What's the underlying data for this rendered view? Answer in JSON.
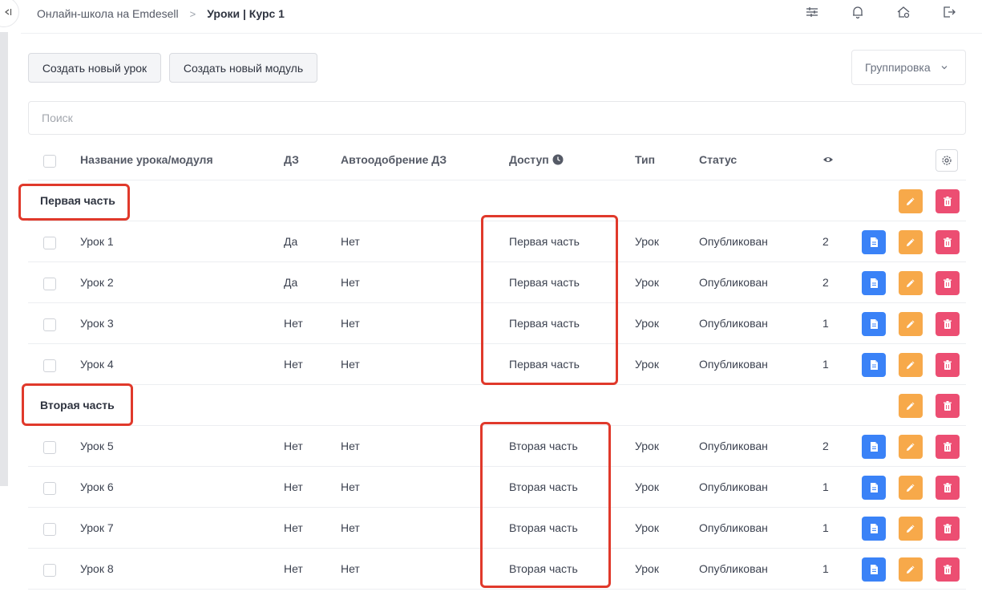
{
  "breadcrumb": {
    "school": "Онлайн-школа на Emdesell",
    "separator": ">",
    "current": "Уроки | Курс 1"
  },
  "header_icons": [
    "filter-sliders-icon",
    "bell-icon",
    "home-settings-icon",
    "logout-icon"
  ],
  "toolbar": {
    "create_lesson": "Создать новый урок",
    "create_module": "Создать новый модуль",
    "grouping": "Группировка"
  },
  "search": {
    "placeholder": "Поиск"
  },
  "table": {
    "headers": {
      "name": "Название урока/модуля",
      "homework": "ДЗ",
      "auto_approve": "Автоодобрение ДЗ",
      "access": "Доступ",
      "type": "Тип",
      "status": "Статус"
    },
    "modules": [
      {
        "title": "Первая часть",
        "lessons": [
          {
            "name": "Урок 1",
            "homework": "Да",
            "auto_approve": "Нет",
            "access": "Первая часть",
            "type": "Урок",
            "status": "Опубликован",
            "views": "2"
          },
          {
            "name": "Урок 2",
            "homework": "Да",
            "auto_approve": "Нет",
            "access": "Первая часть",
            "type": "Урок",
            "status": "Опубликован",
            "views": "2"
          },
          {
            "name": "Урок 3",
            "homework": "Нет",
            "auto_approve": "Нет",
            "access": "Первая часть",
            "type": "Урок",
            "status": "Опубликован",
            "views": "1"
          },
          {
            "name": "Урок 4",
            "homework": "Нет",
            "auto_approve": "Нет",
            "access": "Первая часть",
            "type": "Урок",
            "status": "Опубликован",
            "views": "1"
          }
        ]
      },
      {
        "title": "Вторая часть",
        "lessons": [
          {
            "name": "Урок 5",
            "homework": "Нет",
            "auto_approve": "Нет",
            "access": "Вторая часть",
            "type": "Урок",
            "status": "Опубликован",
            "views": "2"
          },
          {
            "name": "Урок 6",
            "homework": "Нет",
            "auto_approve": "Нет",
            "access": "Вторая часть",
            "type": "Урок",
            "status": "Опубликован",
            "views": "1"
          },
          {
            "name": "Урок 7",
            "homework": "Нет",
            "auto_approve": "Нет",
            "access": "Вторая часть",
            "type": "Урок",
            "status": "Опубликован",
            "views": "1"
          },
          {
            "name": "Урок 8",
            "homework": "Нет",
            "auto_approve": "Нет",
            "access": "Вторая часть",
            "type": "Урок",
            "status": "Опубликован",
            "views": "1"
          }
        ]
      }
    ]
  },
  "colors": {
    "doc_button": "#3a82f7",
    "edit_button": "#f7a94a",
    "delete_button": "#ec4e72",
    "highlight": "#e0392b"
  }
}
